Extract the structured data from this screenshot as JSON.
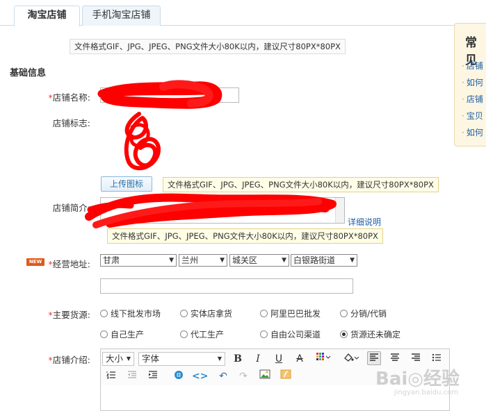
{
  "tabs": [
    {
      "label": "淘宝店铺",
      "active": true
    },
    {
      "label": "手机淘宝店铺",
      "active": false
    }
  ],
  "top_hint": "文件格式GIF、JPG、JPEG、PNG文件大小80K以内，建议尺寸80PX*80PX",
  "section_title": "基础信息",
  "form": {
    "shop_name": {
      "required": "*",
      "label": "店铺名称:",
      "value": ""
    },
    "shop_logo": {
      "label": "店铺标志:",
      "upload_label": "上传图标",
      "hint": "文件格式GIF、JPG、JPEG、PNG文件大小80K以内，建议尺寸80PX*80PX"
    },
    "shop_intro": {
      "label": "店铺简介:",
      "detail_link": "详细说明",
      "hint": "文件格式GIF、JPG、JPEG、PNG文件大小80K以内，建议尺寸80PX*80PX"
    },
    "address": {
      "badge": "NEW",
      "required": "*",
      "label": "经营地址:",
      "province": "甘肃",
      "city": "兰州",
      "district": "城关区",
      "street": "白银路街道",
      "detail_value": ""
    },
    "source": {
      "required": "*",
      "label": "主要货源:",
      "options": [
        {
          "label": "线下批发市场",
          "checked": false
        },
        {
          "label": "实体店拿货",
          "checked": false
        },
        {
          "label": "阿里巴巴批发",
          "checked": false
        },
        {
          "label": "分销/代销",
          "checked": false
        },
        {
          "label": "自己生产",
          "checked": false
        },
        {
          "label": "代工生产",
          "checked": false
        },
        {
          "label": "自由公司渠道",
          "checked": false
        },
        {
          "label": "货源还未确定",
          "checked": true
        }
      ]
    },
    "description": {
      "required": "*",
      "label": "店铺介绍:",
      "size_select": "大小",
      "font_select": "字体"
    }
  },
  "side_panel": {
    "title": "常见",
    "links": [
      "店铺",
      "如何",
      "店铺",
      "宝贝",
      "如何"
    ]
  },
  "watermark": {
    "main": "Bai◎经验",
    "sub": "jingyan.baidu.com"
  },
  "colors": {
    "accent_red": "#e4393c",
    "link_blue": "#1f5fa6",
    "scribble": "#ff0000"
  }
}
